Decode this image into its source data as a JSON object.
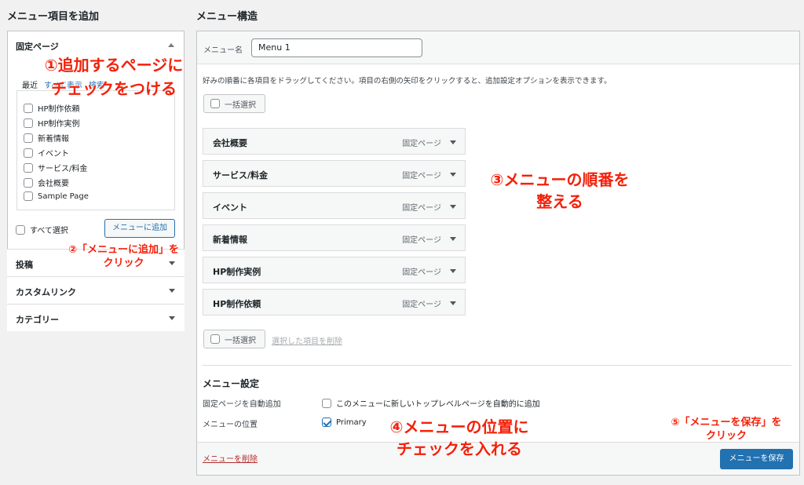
{
  "left": {
    "heading": "メニュー項目を追加",
    "pages_section": {
      "title": "固定ページ",
      "tabs": [
        "最近",
        "すべて表示",
        "検索"
      ],
      "items": [
        "HP制作依頼",
        "HP制作実例",
        "新着情報",
        "イベント",
        "サービス/料金",
        "会社概要",
        "Sample Page"
      ],
      "select_all": "すべて選択",
      "add_button": "メニューに追加"
    },
    "sections": [
      "投稿",
      "カスタムリンク",
      "カテゴリー"
    ]
  },
  "right": {
    "heading": "メニュー構造",
    "menu_name_label": "メニュー名",
    "menu_name_value": "Menu 1",
    "instructions": "好みの順番に各項目をドラッグしてください。項目の右側の矢印をクリックすると、追加設定オプションを表示できます。",
    "bulk_select": "一括選択",
    "delete_selected": "選択した項目を削除",
    "menu_items": [
      {
        "title": "会社概要",
        "type": "固定ページ"
      },
      {
        "title": "サービス/料金",
        "type": "固定ページ"
      },
      {
        "title": "イベント",
        "type": "固定ページ"
      },
      {
        "title": "新着情報",
        "type": "固定ページ"
      },
      {
        "title": "HP制作実例",
        "type": "固定ページ"
      },
      {
        "title": "HP制作依頼",
        "type": "固定ページ"
      }
    ],
    "settings": {
      "heading": "メニュー設定",
      "auto_add_label": "固定ページを自動追加",
      "auto_add_option": "このメニューに新しいトップレベルページを自動的に追加",
      "location_label": "メニューの位置",
      "location_option": "Primary"
    },
    "delete_menu": "メニューを削除",
    "save_button": "メニューを保存"
  },
  "annotations": {
    "a1_line1": "①追加するページに",
    "a1_line2": "チェックをつける",
    "a2_line1": "②「メニューに追加」を",
    "a2_line2": "クリック",
    "a3_line1": "③メニューの順番を",
    "a3_line2": "整える",
    "a4_line1": "④メニューの位置に",
    "a4_line2": "チェックを入れる",
    "a5_line1": "⑤「メニューを保存」を",
    "a5_line2": "クリック"
  },
  "colors": {
    "accent": "#2271b1",
    "annotation": "#f4200a",
    "danger": "#b32d2e"
  },
  "icons": [
    "triangle-up-icon",
    "triangle-down-icon",
    "checkbox-icon",
    "checkmark-icon"
  ]
}
